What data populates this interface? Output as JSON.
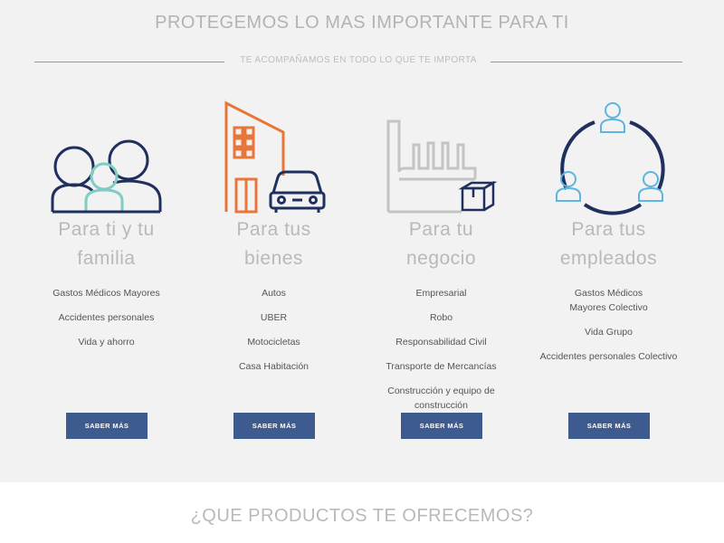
{
  "header": {
    "title": "PROTEGEMOS LO MAS IMPORTANTE PARA TI",
    "subtitle": "TE ACOMPAÑAMOS EN TODO LO QUE TE IMPORTA"
  },
  "colors": {
    "accent_blue": "#1f2f5e",
    "accent_teal": "#7fcdc4",
    "accent_orange": "#e8763a",
    "accent_sky": "#5db5e0",
    "icon_gray": "#c4c4c4",
    "button": "#3d5b8f"
  },
  "columns": [
    {
      "icon": "family-icon",
      "title_line1": "Para ti y tu",
      "title_line2": "familia",
      "items": [
        "Gastos Médicos Mayores",
        "Accidentes personales",
        "Vida y ahorro"
      ],
      "button": "SABER MÁS"
    },
    {
      "icon": "building-car-icon",
      "title_line1": "Para tus",
      "title_line2": "bienes",
      "items": [
        "Autos",
        "UBER",
        "Motocicletas",
        "Casa Habitación"
      ],
      "button": "SABER MÁS"
    },
    {
      "icon": "factory-box-icon",
      "title_line1": "Para tu",
      "title_line2": "negocio",
      "items": [
        "Empresarial",
        "Robo",
        "Responsabilidad Civil",
        "Transporte de Mercancías",
        "Construcción y equipo de construcción"
      ],
      "button": "SABER MÁS"
    },
    {
      "icon": "team-cycle-icon",
      "title_line1": "Para tus",
      "title_line2": "empleados",
      "items": [
        "Gastos Médicos Mayores Colectivo",
        "Vida Grupo",
        "Accidentes personales Colectivo"
      ],
      "button": "SABER MÁS"
    }
  ],
  "products": {
    "title": "¿QUE PRODUCTOS TE OFRECEMOS?"
  }
}
